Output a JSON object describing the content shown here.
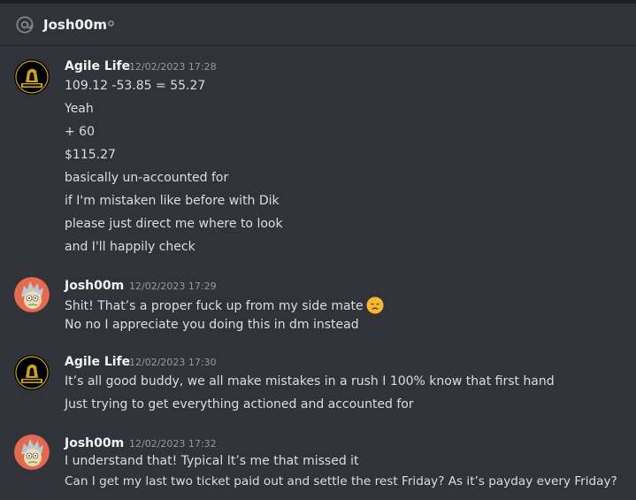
{
  "header": {
    "username": "Josh00m",
    "icon": "at-sign-icon",
    "status": "offline"
  },
  "messages": [
    {
      "author": "Agile Life",
      "timestamp": "12/02/2023 17:28",
      "avatar": "agile-life-logo",
      "lines": [
        "109.12 -53.85 = 55.27",
        "Yeah",
        "+ 60",
        "$115.27",
        "basically un-accounted for",
        "if I'm mistaken like before with Dik",
        "please just direct me where to look",
        "and I'll happily check"
      ]
    },
    {
      "author": "Josh00m",
      "timestamp": "12/02/2023 17:29",
      "avatar": "rick-cartoon-avatar",
      "lines": [
        "Shit! That’s a proper fuck up from my side mate",
        "No no I appreciate you doing this in dm instead"
      ],
      "emoji": "disappointed-face-emoji"
    },
    {
      "author": "Agile Life",
      "timestamp": "12/02/2023 17:30",
      "avatar": "agile-life-logo",
      "lines": [
        "It’s all good buddy, we all make mistakes in a rush I 100% know that first hand",
        "Just trying to get everything actioned and accounted for"
      ]
    },
    {
      "author": "Josh00m",
      "timestamp": "12/02/2023 17:32",
      "avatar": "rick-cartoon-avatar",
      "lines": [
        "I understand that! Typical It’s me that missed it",
        "Can I get my last two ticket paid out and settle the rest Friday? As it’s payday every Friday?"
      ]
    }
  ],
  "colors": {
    "background": "#313338",
    "text": "#dbdee1",
    "author": "#f2f3f5",
    "timestamp": "#949ba4"
  }
}
